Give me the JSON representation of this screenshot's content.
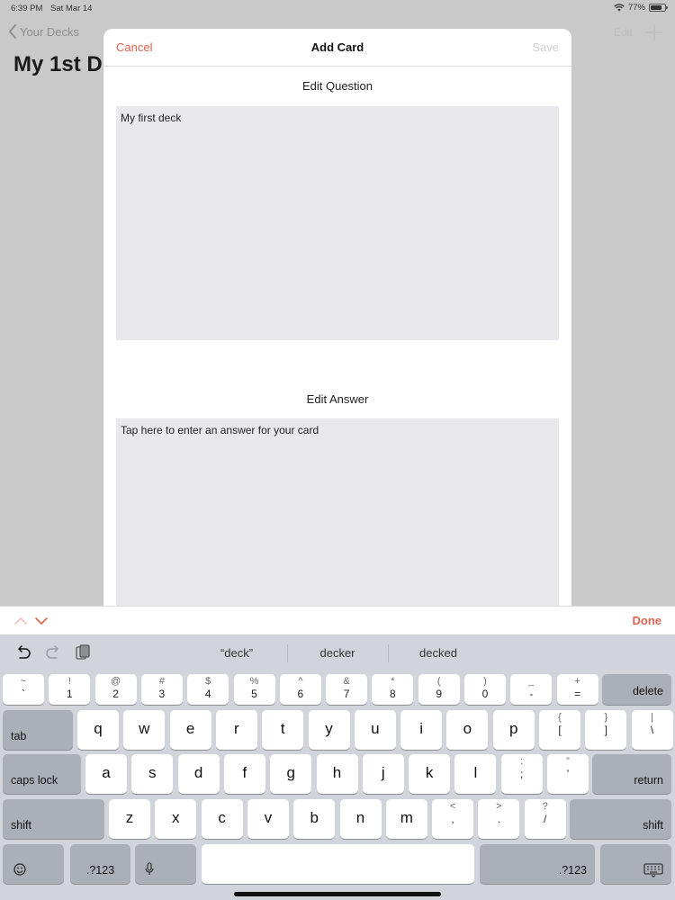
{
  "status_bar": {
    "time": "6:39 PM",
    "date": "Sat Mar 14",
    "battery_percent": "77%",
    "battery_level": 0.77
  },
  "background": {
    "back_label": "Your Decks",
    "title": "My 1st D",
    "edit_label": "Edit"
  },
  "sheet": {
    "cancel_label": "Cancel",
    "title": "Add Card",
    "save_label": "Save",
    "question_label": "Edit Question",
    "question_value": "My first deck",
    "answer_label": "Edit Answer",
    "answer_value": "Tap here to enter an answer for your card"
  },
  "accessory": {
    "done_label": "Done"
  },
  "keyboard": {
    "suggestions": [
      "“deck”",
      "decker",
      "decked"
    ],
    "number_row": [
      {
        "top": "~",
        "bottom": "`"
      },
      {
        "top": "!",
        "bottom": "1"
      },
      {
        "top": "@",
        "bottom": "2"
      },
      {
        "top": "#",
        "bottom": "3"
      },
      {
        "top": "$",
        "bottom": "4"
      },
      {
        "top": "%",
        "bottom": "5"
      },
      {
        "top": "^",
        "bottom": "6"
      },
      {
        "top": "&",
        "bottom": "7"
      },
      {
        "top": "*",
        "bottom": "8"
      },
      {
        "top": "(",
        "bottom": "9"
      },
      {
        "top": ")",
        "bottom": "0"
      },
      {
        "top": "_",
        "bottom": "-"
      },
      {
        "top": "+",
        "bottom": "="
      }
    ],
    "row_q": [
      "q",
      "w",
      "e",
      "r",
      "t",
      "y",
      "u",
      "i",
      "o",
      "p"
    ],
    "row_q_extra": [
      {
        "top": "{",
        "bottom": "["
      },
      {
        "top": "}",
        "bottom": "]"
      },
      {
        "top": "|",
        "bottom": "\\"
      }
    ],
    "row_a": [
      "a",
      "s",
      "d",
      "f",
      "g",
      "h",
      "j",
      "k",
      "l"
    ],
    "row_a_extra": [
      {
        "top": ":",
        "bottom": ";"
      },
      {
        "top": "”",
        "bottom": "’"
      }
    ],
    "row_z": [
      "z",
      "x",
      "c",
      "v",
      "b",
      "n",
      "m"
    ],
    "row_z_extra": [
      {
        "top": "<",
        "bottom": ","
      },
      {
        "top": ">",
        "bottom": "."
      },
      {
        "top": "?",
        "bottom": "/"
      }
    ],
    "delete_label": "delete",
    "tab_label": "tab",
    "caps_label": "caps lock",
    "return_label": "return",
    "shift_label": "shift",
    "numbers_label": ".?123"
  },
  "colors": {
    "accent": "#e0624f",
    "disabled": "#cfcfcf",
    "keyboard_bg": "#d1d4da",
    "key_dark": "#abafb8"
  }
}
